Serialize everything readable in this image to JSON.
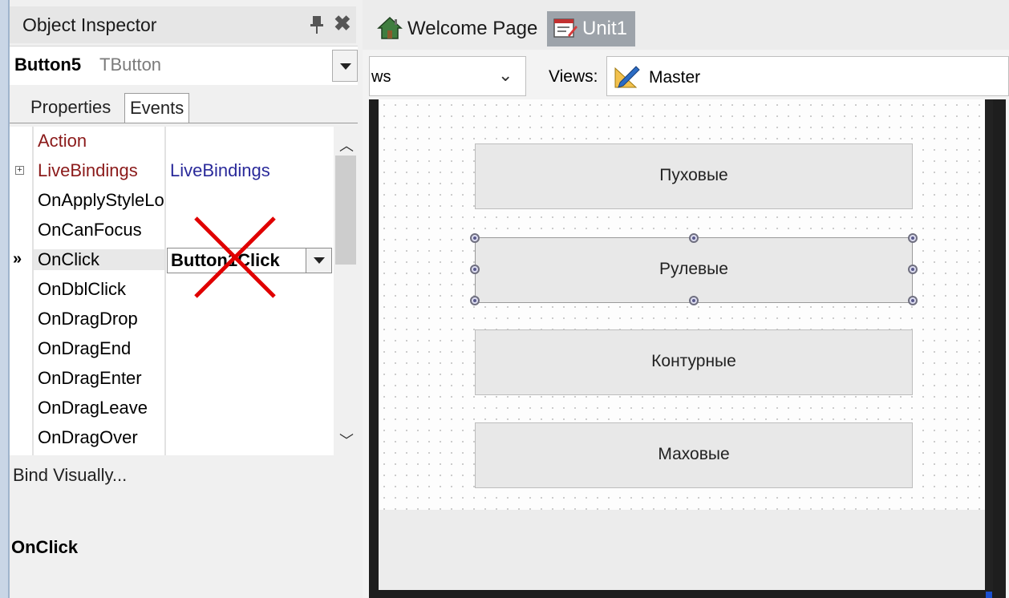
{
  "object_inspector": {
    "title": "Object Inspector",
    "component_name": "Button5",
    "component_type": "TButton",
    "tabs": [
      "Properties",
      "Events"
    ],
    "active_tab": "Events",
    "rows": [
      {
        "name": "Action",
        "value": ""
      },
      {
        "name": "LiveBindings",
        "value": "LiveBindings"
      },
      {
        "name": "OnApplyStyleLookup",
        "value": ""
      },
      {
        "name": "OnCanFocus",
        "value": ""
      },
      {
        "name": "OnClick",
        "value": "Button1Click"
      },
      {
        "name": "OnDblClick",
        "value": ""
      },
      {
        "name": "OnDragDrop",
        "value": ""
      },
      {
        "name": "OnDragEnd",
        "value": ""
      },
      {
        "name": "OnDragEnter",
        "value": ""
      },
      {
        "name": "OnDragLeave",
        "value": ""
      },
      {
        "name": "OnDragOver",
        "value": ""
      }
    ],
    "bind_visually": "Bind Visually...",
    "footer_property": "OnClick"
  },
  "designer": {
    "tabs": [
      "Welcome Page",
      "Unit1"
    ],
    "active_tab": "Unit1",
    "platform_partial": "ws",
    "views_label": "Views:",
    "views_value": "Master",
    "buttons": [
      "Пуховые",
      "Рулевые",
      "Контурные",
      "Маховые"
    ],
    "selected_button": "Рулевые"
  },
  "colors": {
    "category_text": "#8b1a1a",
    "link_value": "#2a2a9a",
    "active_tab_bg": "#9da3aa",
    "selection_handle": "#6f6f7f",
    "red_cross": "#e00000"
  }
}
